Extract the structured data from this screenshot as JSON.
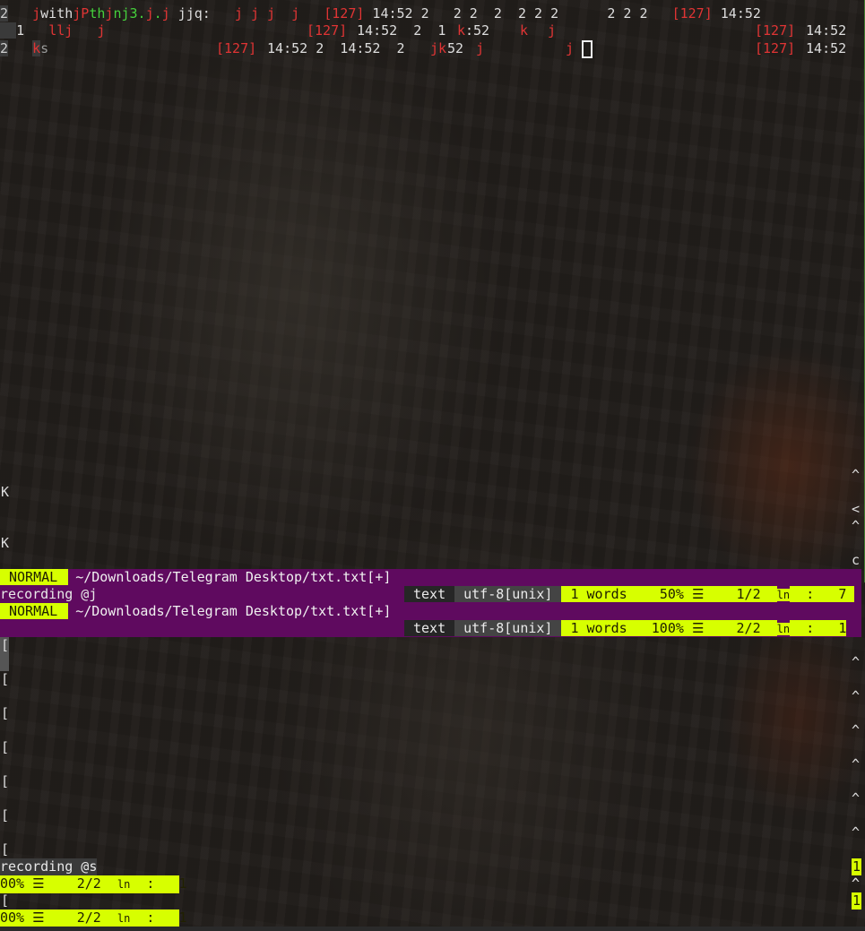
{
  "top_window": {
    "line1": {
      "num": "2",
      "seg": [
        "j",
        "with",
        "jP",
        "th",
        "j",
        "nj3.",
        "j",
        ".",
        "j",
        " jjq:   ",
        "j j j  j   ",
        "[127]",
        " 14:52 2   2 2  2  2 2 2      2 2 2   ",
        "[127]",
        " 14:52"
      ]
    },
    "line2": {
      "num": "1",
      "seg": [
        "llj   j",
        "[127]",
        " 14:52  2  1",
        "k",
        ":52",
        "k",
        "j",
        "[127]",
        " 14:52"
      ]
    },
    "line3": {
      "num": "2",
      "seg": [
        "k",
        "s",
        "[127]",
        " 14:52 2  14:52  2 ",
        "jk",
        "52 ",
        "j",
        "j",
        "[127]",
        " 14:52"
      ]
    }
  },
  "mid_marks": [
    "K",
    "K"
  ],
  "right_marks": [
    "^",
    "<",
    "^",
    "c",
    "^",
    "^",
    "^",
    "^",
    "^",
    "^",
    "^",
    "^"
  ],
  "status1": {
    "mode": "NORMAL",
    "path": "~/Downloads/Telegram Desktop/txt.txt[+]"
  },
  "status2": {
    "left": "recording @j",
    "filetype": "text",
    "encoding": "utf-8[unix]",
    "words": "1 words",
    "percent": "50%",
    "menu_icon": "☰",
    "position": "1/2",
    "ln": "ln",
    "colon": ":",
    "col": "7"
  },
  "status3": {
    "mode": "NORMAL",
    "path": "~/Downloads/Telegram Desktop/txt.txt[+]"
  },
  "status4": {
    "filetype": "text",
    "encoding": "utf-8[unix]",
    "words": "1 words",
    "percent": "100%",
    "menu_icon": "☰",
    "position": "2/2",
    "ln": "ln",
    "colon": ":",
    "col": "1"
  },
  "bracket_lines": [
    "[",
    "[",
    "[",
    "[",
    "[",
    "[",
    "["
  ],
  "bottom": {
    "recording": "recording @s",
    "status_a": {
      "percent": "00%",
      "menu_icon": "☰",
      "position": "2/2",
      "ln": "ln",
      "colon": ":",
      "col": "1"
    },
    "bracket": "[",
    "status_b": {
      "percent": "00%",
      "menu_icon": "☰",
      "position": "2/2",
      "ln": "ln",
      "colon": ":",
      "col": "1"
    },
    "right_num1": "1",
    "right_caret": "^",
    "right_num2": "1"
  }
}
